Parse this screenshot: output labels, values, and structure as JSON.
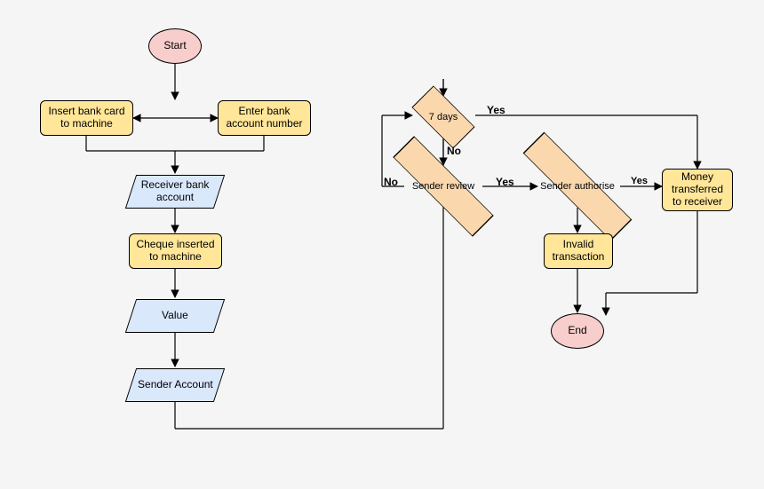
{
  "nodes": {
    "start": "Start",
    "insert_card": "Insert bank card to machine",
    "enter_account": "Enter bank account number",
    "receiver_account": "Receiver bank account",
    "cheque": "Cheque inserted to machine",
    "value": "Value",
    "sender_account": "Sender Account",
    "seven_days": "7 days",
    "sender_review": "Sender review",
    "sender_authorise": "Sender authorise",
    "invalid": "Invalid transaction",
    "transferred": "Money transferred to receiver",
    "end": "End"
  },
  "edges": {
    "yes": "Yes",
    "no": "No"
  }
}
